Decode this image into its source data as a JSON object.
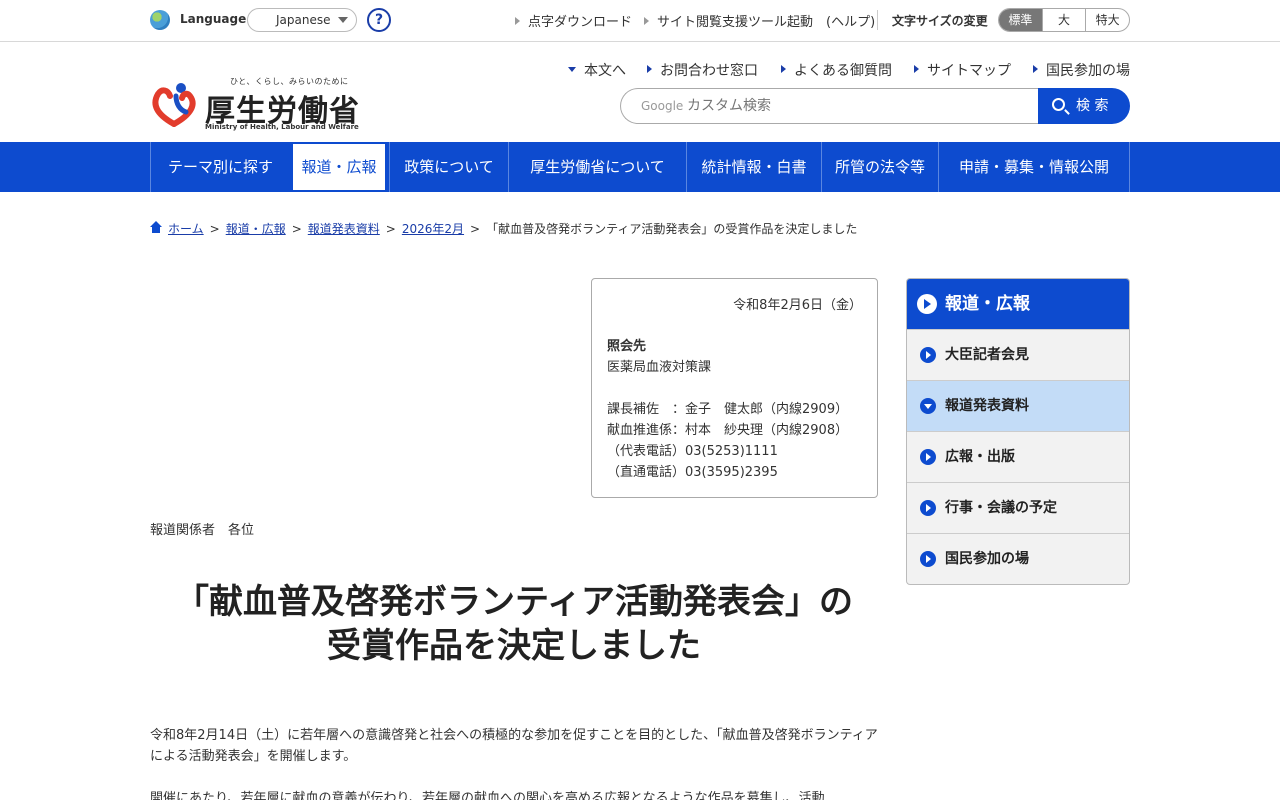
{
  "utility": {
    "language_label": "Language",
    "language_value": "Japanese",
    "help_symbol": "?",
    "links": [
      "点字ダウンロード",
      "サイト閲覧支援ツール起動　(ヘルプ)"
    ],
    "font_size_label": "文字サイズの変更",
    "font_sizes": [
      "標準",
      "大",
      "特大"
    ]
  },
  "header": {
    "tagline": "ひと、くらし、みらいのために",
    "logo_title": "厚生労働省",
    "logo_en": "Ministry of Health, Labour and Welfare",
    "sub_links": [
      "本文へ",
      "お問合わせ窓口",
      "よくある御質問",
      "サイトマップ",
      "国民参加の場"
    ],
    "search_brand": "Google",
    "search_placeholder": "カスタム検索",
    "search_button": "検 索"
  },
  "nav": [
    "テーマ別に探す",
    "報道・広報",
    "政策について",
    "厚生労働省について",
    "統計情報・白書",
    "所管の法令等",
    "申請・募集・情報公開"
  ],
  "breadcrumb": [
    "ホーム",
    "報道・広報",
    "報道発表資料",
    "2026年2月",
    "「献血普及啓発ボランティア活動発表会」の受賞作品を決定しました"
  ],
  "contact": {
    "date": "令和8年2月6日（金）",
    "title": "照会先",
    "dept": "医薬局血液対策課",
    "lines": [
      "課長補佐　：金子　健太郎（内線2909）",
      "献血推進係：村本　紗央理（内線2908）",
      "（代表電話）03(5253)1111",
      "（直通電話）03(3595)2395"
    ]
  },
  "addressee": "報道関係者　各位",
  "headline": [
    "「献血普及啓発ボランティア活動発表会」の",
    "受賞作品を決定しました"
  ],
  "paragraphs": [
    "令和8年2月14日（土）に若年層への意識啓発と社会への積極的な参加を促すことを目的とした、「献血普及啓発ボランティアによる活動発表会」を開催します。",
    "開催にあたり、若年層に献血の意義が伝わり、若年層の献血への関心を高める広報となるような作品を募集し、活動"
  ],
  "sidebar": {
    "title": "報道・広報",
    "items": [
      "大臣記者会見",
      "報道発表資料",
      "広報・出版",
      "行事・会議の予定",
      "国民参加の場"
    ],
    "active_index": 1
  },
  "colors": {
    "primary": "#0d4bcf",
    "active_side": "#c3dcf7"
  }
}
